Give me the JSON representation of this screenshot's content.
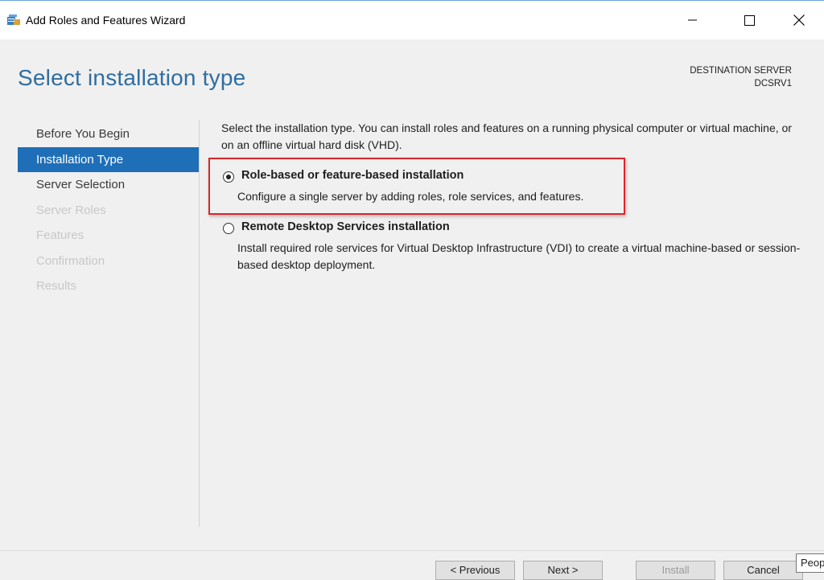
{
  "window": {
    "title": "Add Roles and Features Wizard"
  },
  "header": {
    "page_title": "Select installation type",
    "destination_label": "DESTINATION SERVER",
    "destination_server": "DCSRV1"
  },
  "nav": {
    "items": [
      {
        "label": "Before You Begin",
        "state": "enabled"
      },
      {
        "label": "Installation Type",
        "state": "active"
      },
      {
        "label": "Server Selection",
        "state": "enabled"
      },
      {
        "label": "Server Roles",
        "state": "disabled"
      },
      {
        "label": "Features",
        "state": "disabled"
      },
      {
        "label": "Confirmation",
        "state": "disabled"
      },
      {
        "label": "Results",
        "state": "disabled"
      }
    ]
  },
  "main": {
    "intro": "Select the installation type. You can install roles and features on a running physical computer or virtual machine, or on an offline virtual hard disk (VHD).",
    "options": [
      {
        "title": "Role-based or feature-based installation",
        "description": "Configure a single server by adding roles, role services, and features.",
        "selected": true
      },
      {
        "title": "Remote Desktop Services installation",
        "description": "Install required role services for Virtual Desktop Infrastructure (VDI) to create a virtual machine-based or session-based desktop deployment.",
        "selected": false
      }
    ]
  },
  "footer": {
    "previous_label": "< Previous",
    "next_label": "Next >",
    "install_label": "Install",
    "cancel_label": "Cancel",
    "peek_text": "Peop"
  },
  "colors": {
    "accent": "#1e6fb8",
    "title_blue": "#2f6e9f",
    "highlight_red": "#d9262b"
  },
  "icons": {
    "app": "server-manager-icon",
    "minimize": "minimize-icon",
    "maximize": "maximize-icon",
    "close": "close-icon"
  }
}
